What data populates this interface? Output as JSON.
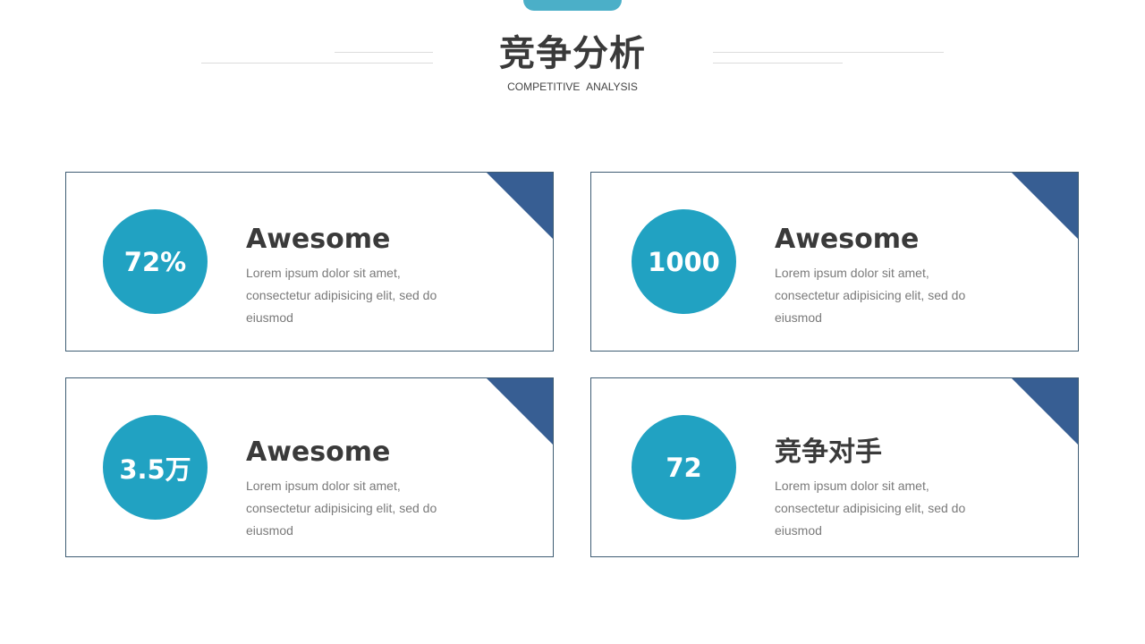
{
  "header": {
    "title": "竞争分析",
    "subtitle": "COMPETITIVE  ANALYSIS"
  },
  "colors": {
    "accent_circle": "#21a2c2",
    "corner": "#375e93",
    "tab": "#4bafc8",
    "card_border": "#3f5d74",
    "heading_text": "#3a3a3a",
    "body_text": "#7a7a7a"
  },
  "cards": [
    {
      "stat": "72%",
      "heading": "Awesome",
      "description": "Lorem ipsum dolor sit amet, consectetur adipisicing elit, sed do eiusmod"
    },
    {
      "stat": "1000",
      "heading": "Awesome",
      "description": "Lorem ipsum dolor sit amet, consectetur adipisicing elit, sed do eiusmod"
    },
    {
      "stat": "3.5万",
      "heading": "Awesome",
      "description": "Lorem ipsum dolor sit amet, consectetur adipisicing elit, sed do eiusmod"
    },
    {
      "stat": "72",
      "heading": "竞争对手",
      "description": "Lorem ipsum dolor sit amet, consectetur adipisicing elit, sed do eiusmod"
    }
  ]
}
